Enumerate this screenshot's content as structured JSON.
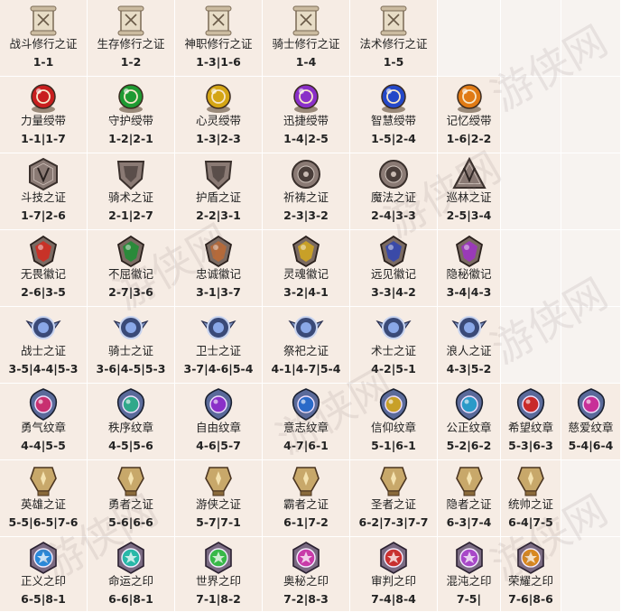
{
  "watermark": "游侠网",
  "rows": [
    [
      {
        "name": "战斗修行之证",
        "code": "1-1",
        "icon": "scroll-icon",
        "color": "#b9a88f"
      },
      {
        "name": "生存修行之证",
        "code": "1-2",
        "icon": "scroll-icon",
        "color": "#b9a88f"
      },
      {
        "name": "神职修行之证",
        "code": "1-3|1-6",
        "icon": "scroll-icon",
        "color": "#b9a88f"
      },
      {
        "name": "骑士修行之证",
        "code": "1-4",
        "icon": "scroll-icon",
        "color": "#b9a88f"
      },
      {
        "name": "法术修行之证",
        "code": "1-5",
        "icon": "scroll-icon",
        "color": "#b9a88f"
      }
    ],
    [
      {
        "name": "力量绶带",
        "code": "1-1|1-7",
        "icon": "red-orb-icon",
        "color": "#c81e1e"
      },
      {
        "name": "守护绶带",
        "code": "1-2|2-1",
        "icon": "green-orb-icon",
        "color": "#1e9a32"
      },
      {
        "name": "心灵绶带",
        "code": "1-3|2-3",
        "icon": "gold-orb-icon",
        "color": "#d4a514"
      },
      {
        "name": "迅捷绶带",
        "code": "1-4|2-5",
        "icon": "purple-orb-icon",
        "color": "#8a2fc8"
      },
      {
        "name": "智慧绶带",
        "code": "1-5|2-4",
        "icon": "blue-orb-icon",
        "color": "#2448c8"
      },
      {
        "name": "记忆绶带",
        "code": "1-6|2-2",
        "icon": "orange-orb-icon",
        "color": "#e07a14"
      }
    ],
    [
      {
        "name": "斗技之证",
        "code": "1-7|2-6",
        "icon": "hexagon-emblem-icon",
        "color": "#6a5a55"
      },
      {
        "name": "骑术之证",
        "code": "2-1|2-7",
        "icon": "shield-emblem-icon",
        "color": "#6a5a55"
      },
      {
        "name": "护盾之证",
        "code": "2-2|3-1",
        "icon": "shield-emblem-icon",
        "color": "#6a5a55"
      },
      {
        "name": "祈祷之证",
        "code": "2-3|3-2",
        "icon": "round-emblem-icon",
        "color": "#6a5a55"
      },
      {
        "name": "魔法之证",
        "code": "2-4|3-3",
        "icon": "round-emblem-icon",
        "color": "#6a5a55"
      },
      {
        "name": "巡林之证",
        "code": "2-5|3-4",
        "icon": "triangle-emblem-icon",
        "color": "#6a5a55"
      }
    ],
    [
      {
        "name": "无畏徽记",
        "code": "2-6|3-5",
        "icon": "red-crest-icon",
        "color": "#c83228"
      },
      {
        "name": "不屈徽记",
        "code": "2-7|3-6",
        "icon": "green-crest-icon",
        "color": "#2a8a3a"
      },
      {
        "name": "忠诚徽记",
        "code": "3-1|3-7",
        "icon": "copper-crest-icon",
        "color": "#b56a3a"
      },
      {
        "name": "灵魂徽记",
        "code": "3-2|4-1",
        "icon": "gold-crest-icon",
        "color": "#c8a028"
      },
      {
        "name": "远见徽记",
        "code": "3-3|4-2",
        "icon": "blue-crest-icon",
        "color": "#3a4aa8"
      },
      {
        "name": "隐秘徽记",
        "code": "3-4|4-3",
        "icon": "violet-crest-icon",
        "color": "#9a3ab8"
      }
    ],
    [
      {
        "name": "战士之证",
        "code": "3-5|4-4|5-3",
        "icon": "winged-emblem-icon",
        "color": "#5a7ab8"
      },
      {
        "name": "骑士之证",
        "code": "3-6|4-5|5-3",
        "icon": "winged-emblem-icon",
        "color": "#5a7ab8"
      },
      {
        "name": "卫士之证",
        "code": "3-7|4-6|5-4",
        "icon": "winged-emblem-icon",
        "color": "#5a7ab8"
      },
      {
        "name": "祭祀之证",
        "code": "4-1|4-7|5-4",
        "icon": "winged-emblem-icon",
        "color": "#5a7ab8"
      },
      {
        "name": "术士之证",
        "code": "4-2|5-1",
        "icon": "winged-emblem-icon",
        "color": "#5a7ab8"
      },
      {
        "name": "浪人之证",
        "code": "4-3|5-2",
        "icon": "winged-emblem-icon",
        "color": "#5a7ab8"
      }
    ],
    [
      {
        "name": "勇气纹章",
        "code": "4-4|5-5",
        "icon": "heraldry-icon",
        "color": "#c83070"
      },
      {
        "name": "秩序纹章",
        "code": "4-5|5-6",
        "icon": "heraldry-icon",
        "color": "#30a88a"
      },
      {
        "name": "自由纹章",
        "code": "4-6|5-7",
        "icon": "heraldry-icon",
        "color": "#8a30c8"
      },
      {
        "name": "意志纹章",
        "code": "4-7|6-1",
        "icon": "heraldry-icon",
        "color": "#2a6ac8"
      },
      {
        "name": "信仰纹章",
        "code": "5-1|6-1",
        "icon": "heraldry-icon",
        "color": "#c8a028"
      },
      {
        "name": "公正纹章",
        "code": "5-2|6-2",
        "icon": "heraldry-icon",
        "color": "#2a9ac8"
      },
      {
        "name": "希望纹章",
        "code": "5-3|6-3",
        "icon": "heraldry-icon",
        "color": "#c82a2a"
      },
      {
        "name": "慈爱纹章",
        "code": "5-4|6-4",
        "icon": "heraldry-icon",
        "color": "#c83098"
      }
    ],
    [
      {
        "name": "英雄之证",
        "code": "5-5|6-5|7-6",
        "icon": "trophy-icon",
        "color": "#c8a050"
      },
      {
        "name": "勇者之证",
        "code": "5-6|6-6",
        "icon": "trophy-icon",
        "color": "#c8a050"
      },
      {
        "name": "游侠之证",
        "code": "5-7|7-1",
        "icon": "trophy-icon",
        "color": "#c8a050"
      },
      {
        "name": "霸者之证",
        "code": "6-1|7-2",
        "icon": "trophy-icon",
        "color": "#c8a050"
      },
      {
        "name": "圣者之证",
        "code": "6-2|7-3|7-7",
        "icon": "trophy-icon",
        "color": "#c8a050"
      },
      {
        "name": "隐者之证",
        "code": "6-3|7-4",
        "icon": "trophy-icon",
        "color": "#c8a050"
      },
      {
        "name": "统帅之证",
        "code": "6-4|7-5",
        "icon": "trophy-icon",
        "color": "#c8a050"
      }
    ],
    [
      {
        "name": "正义之印",
        "code": "6-5|8-1",
        "icon": "seal-icon",
        "color": "#2a88d8"
      },
      {
        "name": "命运之印",
        "code": "6-6|8-1",
        "icon": "seal-icon",
        "color": "#28b8a8"
      },
      {
        "name": "世界之印",
        "code": "7-1|8-2",
        "icon": "seal-icon",
        "color": "#38b848"
      },
      {
        "name": "奥秘之印",
        "code": "7-2|8-3",
        "icon": "seal-icon",
        "color": "#c83aa8"
      },
      {
        "name": "审判之印",
        "code": "7-4|8-4",
        "icon": "seal-icon",
        "color": "#c83030"
      },
      {
        "name": "混沌之印",
        "code": "7-5|",
        "icon": "seal-icon",
        "color": "#a848c8"
      },
      {
        "name": "荣耀之印",
        "code": "7-6|8-6",
        "icon": "seal-icon",
        "color": "#d88820"
      }
    ]
  ]
}
